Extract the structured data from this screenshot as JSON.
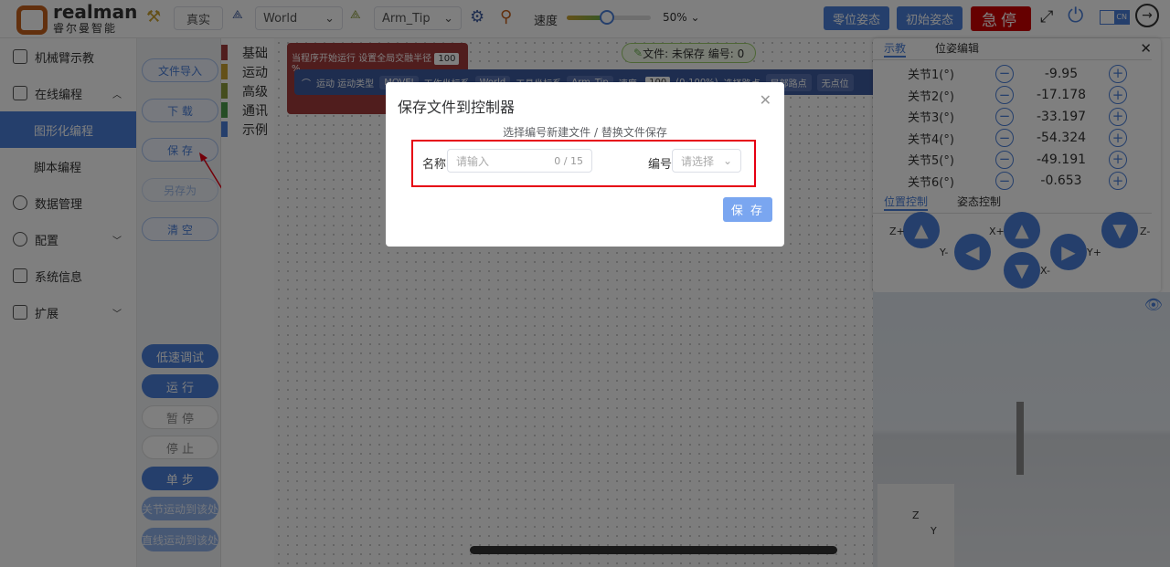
{
  "brand": {
    "name": "realman",
    "subtitle": "睿尔曼智能",
    "color": "#c4601c"
  },
  "topbar": {
    "mode": "真实",
    "work_frame": "World",
    "tool_frame": "Arm_Tip",
    "speed_label": "速度",
    "speed_value": "50%",
    "speed_percent": 50,
    "zero_pose": "零位姿态",
    "init_pose": "初始姿态",
    "estop": "急停",
    "lang": "CN"
  },
  "sidebar": {
    "items": [
      {
        "label": "机械臂示教",
        "icon": "home-icon"
      },
      {
        "label": "在线编程",
        "icon": "code-icon",
        "expanded": true
      },
      {
        "label": "图形化编程",
        "sub": true,
        "active": true
      },
      {
        "label": "脚本编程",
        "sub": true
      },
      {
        "label": "数据管理",
        "icon": "database-icon"
      },
      {
        "label": "配置",
        "icon": "gear-icon"
      },
      {
        "label": "系统信息",
        "icon": "chart-icon"
      },
      {
        "label": "扩展",
        "icon": "grid-icon"
      }
    ]
  },
  "file_actions": {
    "import": "文件导入",
    "download": "下 载",
    "save": "保 存",
    "save_as": "另存为",
    "clear": "清 空"
  },
  "run_actions": {
    "slow_debug": "低速调试",
    "run": "运 行",
    "pause": "暂 停",
    "stop": "停 止",
    "step": "单 步",
    "joint_move": "关节运动到该处",
    "linear_move": "直线运动到该处"
  },
  "categories": [
    {
      "label": "基础",
      "color": "#a13a3a"
    },
    {
      "label": "运动",
      "color": "#c9a030"
    },
    {
      "label": "高级",
      "color": "#8a9a3a"
    },
    {
      "label": "通讯",
      "color": "#4a9a4a"
    },
    {
      "label": "示例",
      "color": "#4a7fd8"
    }
  ],
  "blocks": {
    "start_text": "当程序开始运行 设置全局交融半径",
    "blend_radius": "100",
    "percent": "%",
    "motion": "运动 运动类型",
    "motion_type": "MOVEJ",
    "work_frame_label": "工作坐标系",
    "work_frame": "World",
    "tool_frame_label": "工具坐标系",
    "tool_frame": "Arm_Tip",
    "speed_label": "速度:",
    "speed": "100",
    "speed_range": "(0-100%)",
    "waypoint_label": "选择路点",
    "waypoint_type": "局部路点",
    "waypoint": "无点位"
  },
  "file_status": "文件: 未保存  编号: 0",
  "teach_panel": {
    "tabs": [
      "示教",
      "位姿编辑"
    ],
    "joints": [
      {
        "label": "关节1(°)",
        "value": "-9.95"
      },
      {
        "label": "关节2(°)",
        "value": "-17.178"
      },
      {
        "label": "关节3(°)",
        "value": "-33.197"
      },
      {
        "label": "关节4(°)",
        "value": "-54.324"
      },
      {
        "label": "关节5(°)",
        "value": "-49.191"
      },
      {
        "label": "关节6(°)",
        "value": "-0.653"
      }
    ],
    "control_tabs": [
      "位置控制",
      "姿态控制"
    ],
    "axes": {
      "zp": "Z+",
      "zm": "Z-",
      "xp": "X+",
      "xm": "X-",
      "yp": "Y+",
      "ym": "Y-"
    }
  },
  "view3d": {
    "axis_z": "Z",
    "axis_y": "Y"
  },
  "dialog": {
    "title": "保存文件到控制器",
    "hint": "选择编号新建文件 / 替换文件保存",
    "name_label": "名称",
    "name_placeholder": "请输入",
    "name_count": "0 / 15",
    "number_label": "编号",
    "number_placeholder": "请选择",
    "save": "保 存"
  }
}
